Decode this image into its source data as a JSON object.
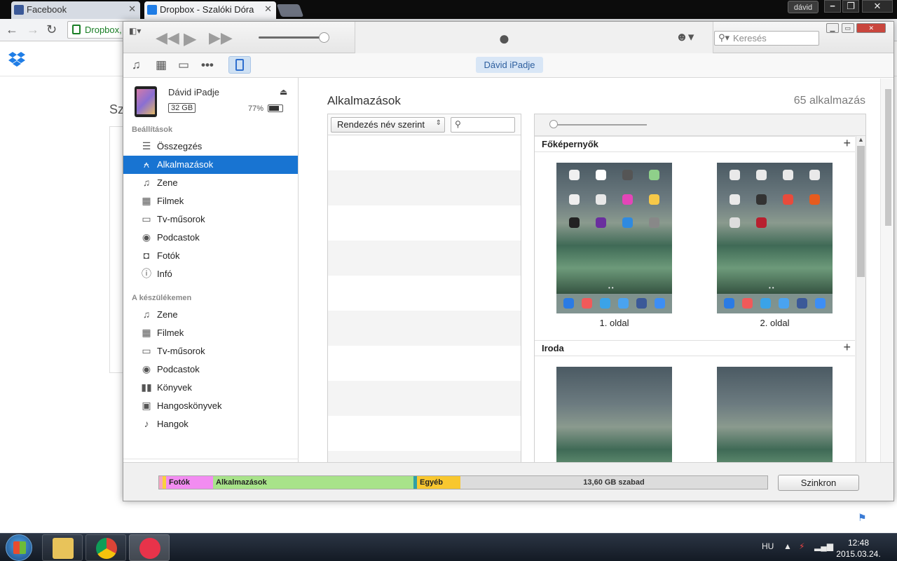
{
  "browser": {
    "tabs": [
      {
        "title": "Facebook",
        "active": false,
        "favicon_color": "#3b5998"
      },
      {
        "title": "Dropbox - Szalóki Dóra",
        "active": true,
        "favicon_color": "#1f7de6"
      }
    ],
    "user": "dávid",
    "address": "Dropbox,",
    "page_heading_fragment": "Sz"
  },
  "itunes": {
    "search_placeholder": "Keresés",
    "device_pill": "Dávid iPadje",
    "device": {
      "name": "Dávid iPadje",
      "capacity": "32 GB",
      "battery": "77%",
      "battery_level": 0.77
    },
    "sidebar": {
      "settings_label": "Beállítások",
      "settings_items": [
        {
          "label": "Összegzés",
          "icon": "summary-icon",
          "selected": false
        },
        {
          "label": "Alkalmazások",
          "icon": "apps-icon",
          "selected": true
        },
        {
          "label": "Zene",
          "icon": "music-icon",
          "selected": false
        },
        {
          "label": "Filmek",
          "icon": "film-icon",
          "selected": false
        },
        {
          "label": "Tv-műsorok",
          "icon": "tv-icon",
          "selected": false
        },
        {
          "label": "Podcastok",
          "icon": "podcast-icon",
          "selected": false
        },
        {
          "label": "Fotók",
          "icon": "camera-icon",
          "selected": false
        },
        {
          "label": "Infó",
          "icon": "info-icon",
          "selected": false
        }
      ],
      "device_label": "A készülékemen",
      "device_items": [
        {
          "label": "Zene",
          "icon": "music-icon"
        },
        {
          "label": "Filmek",
          "icon": "film-icon"
        },
        {
          "label": "Tv-műsorok",
          "icon": "tv-icon"
        },
        {
          "label": "Podcastok",
          "icon": "podcast-icon"
        },
        {
          "label": "Könyvek",
          "icon": "book-icon"
        },
        {
          "label": "Hangoskönyvek",
          "icon": "audiobook-icon"
        },
        {
          "label": "Hangok",
          "icon": "bell-icon"
        }
      ]
    },
    "main": {
      "title": "Alkalmazások",
      "app_count": "65 alkalmazás",
      "sort_label": "Rendezés név szerint",
      "home_screens": {
        "section_title": "Főképernyők",
        "pages": [
          "1. oldal",
          "2. oldal"
        ]
      },
      "folder_section": {
        "section_title": "Iroda"
      }
    },
    "storage": {
      "segments": [
        {
          "label": "",
          "color": "#f4a6c2",
          "fraction": 0.006
        },
        {
          "label": "",
          "color": "#f9d13c",
          "fraction": 0.006
        },
        {
          "label": "Fotók",
          "color": "#f28cf1",
          "fraction": 0.077
        },
        {
          "label": "Alkalmazások",
          "color": "#a8e38a",
          "fraction": 0.33
        },
        {
          "label": "",
          "color": "#2f9fa6",
          "fraction": 0.006
        },
        {
          "label": "Egyéb",
          "color": "#f8c72f",
          "fraction": 0.072
        }
      ],
      "free_label": "13,60 GB szabad",
      "sync_label": "Szinkron"
    }
  },
  "taskbar": {
    "language": "HU",
    "time": "12:48",
    "date": "2015.03.24."
  }
}
